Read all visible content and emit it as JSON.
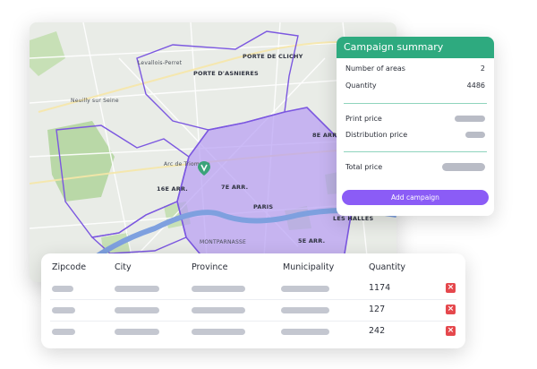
{
  "map": {
    "labels": [
      "Levallois-Perret",
      "Neuilly sur Seine",
      "PORTE D'ASNIERES",
      "PORTE DE CLICHY",
      "8E ARR.",
      "16E ARR.",
      "Arc de Triomphe",
      "7E ARR.",
      "LES HALLES",
      "5E ARR.",
      "PARIS",
      "MONTPARNASSE"
    ],
    "colors": {
      "area_fill": "#b79cf4",
      "area_stroke": "#7b57e0",
      "water": "#7ea0df",
      "park": "#b9d8a7",
      "pin": "#3ba37a"
    }
  },
  "summary": {
    "title": "Campaign summary",
    "rows": [
      {
        "label": "Number of areas",
        "value": "2"
      },
      {
        "label": "Quantity",
        "value": "4486"
      }
    ],
    "price_rows": [
      {
        "label": "Print price"
      },
      {
        "label": "Distribution price"
      }
    ],
    "total_label": "Total price",
    "button_label": "Add campaign",
    "colors": {
      "header": "#2eaa7f",
      "button": "#8b5cf6"
    }
  },
  "table": {
    "columns": [
      "Zipcode",
      "City",
      "Province",
      "Municipality",
      "Quantity"
    ],
    "rows": [
      {
        "quantity": "1174"
      },
      {
        "quantity": "127"
      },
      {
        "quantity": "242"
      }
    ],
    "delete_icon": "close-icon"
  }
}
